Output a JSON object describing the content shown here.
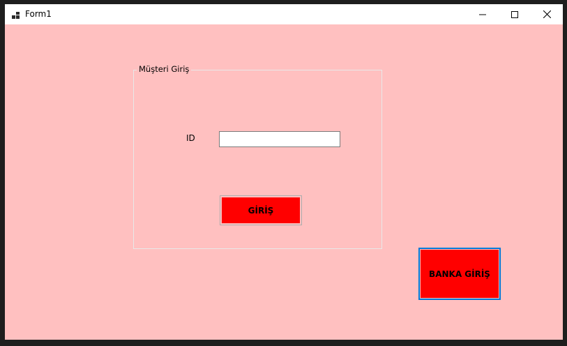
{
  "window": {
    "title": "Form1",
    "icon": "winforms-app-icon",
    "background_color": "#ffc0c0",
    "controls": {
      "minimize_icon": "minimize-icon",
      "maximize_icon": "maximize-icon",
      "close_icon": "close-icon"
    }
  },
  "customer_login": {
    "group_title": "Müşteri Giriş",
    "id_label": "ID",
    "id_value": "",
    "login_button_label": "GİRİŞ",
    "button_color": "#ff0000"
  },
  "bank_login": {
    "button_label": "BANKA GİRİŞ",
    "button_color": "#ff0000",
    "focus_border_color": "#0078d7"
  }
}
